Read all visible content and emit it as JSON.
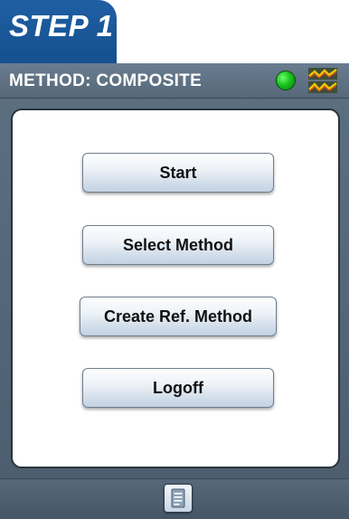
{
  "step": {
    "label": "STEP 1"
  },
  "titlebar": {
    "title": "METHOD: COMPOSITE",
    "status_color": "#19c21d",
    "signal_icon": "signal-icon"
  },
  "menu": {
    "buttons": [
      {
        "label": "Start"
      },
      {
        "label": "Select Method"
      },
      {
        "label": "Create Ref. Method"
      },
      {
        "label": "Logoff"
      }
    ]
  },
  "footer": {
    "doc_icon": "document-icon"
  },
  "colors": {
    "step_tab": "#1f5fa3",
    "frame": "#5d7082",
    "panel": "#ffffff",
    "button_gradient_bottom": "#c3d2e2"
  }
}
